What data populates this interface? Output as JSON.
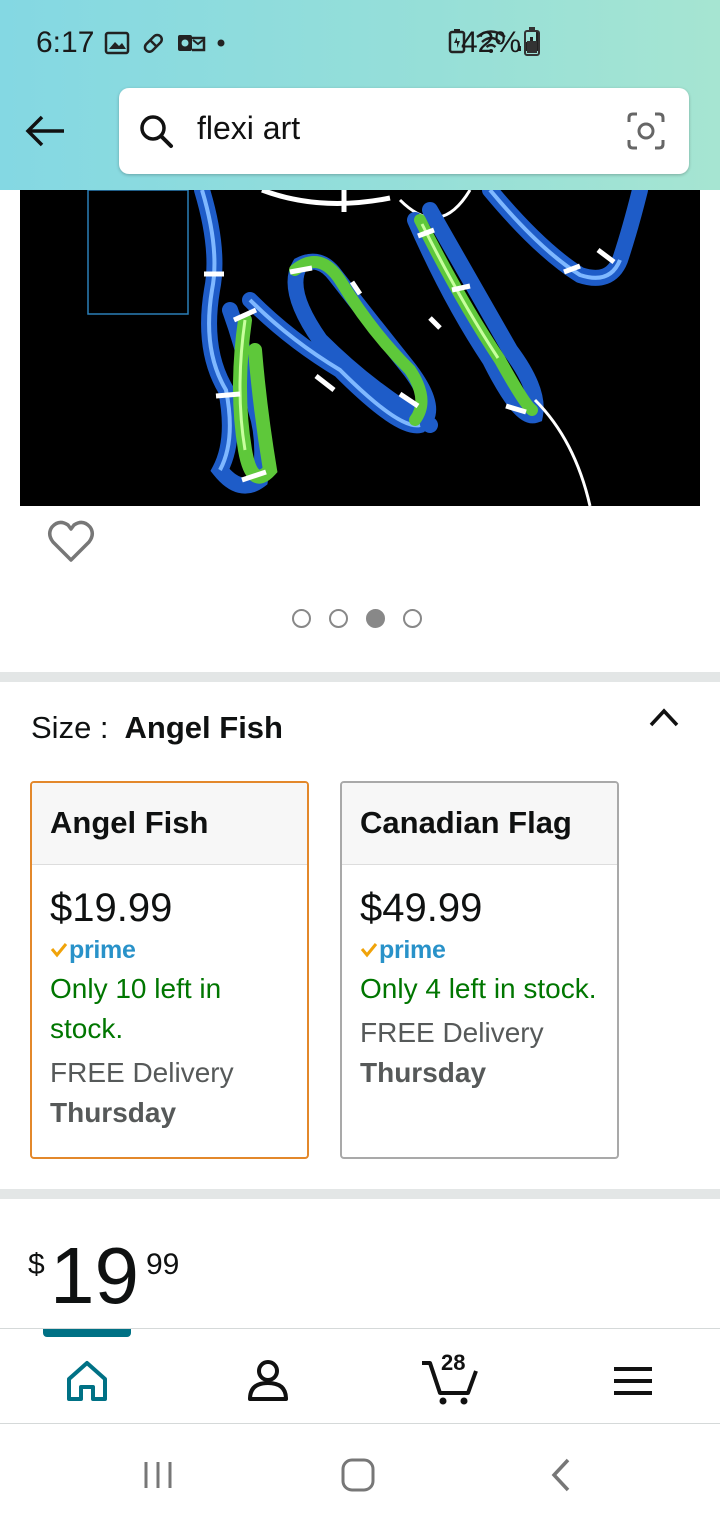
{
  "status_bar": {
    "time": "6:17",
    "battery": "42%"
  },
  "search": {
    "query": "flexi art"
  },
  "product": {
    "image_dots": 4,
    "active_dot": 3
  },
  "size_selector": {
    "label": "Size :",
    "selected": "Angel Fish",
    "options": [
      {
        "name": "Angel Fish",
        "price": "$19.99",
        "prime": "prime",
        "stock": "Only 10 left in stock.",
        "delivery": "FREE Delivery",
        "delivery_day": "Thursday"
      },
      {
        "name": "Canadian Flag",
        "price": "$49.99",
        "prime": "prime",
        "stock": "Only 4 left in stock.",
        "delivery": "FREE Delivery",
        "delivery_day": "Thursday"
      }
    ]
  },
  "price": {
    "symbol": "$",
    "whole": "19",
    "fraction": "99"
  },
  "bottom_nav": {
    "cart_count": "28"
  },
  "colors": {
    "accent": "#007185",
    "selected_border": "#e3882b",
    "stock_green": "#007600",
    "prime_blue": "#2992c9"
  }
}
